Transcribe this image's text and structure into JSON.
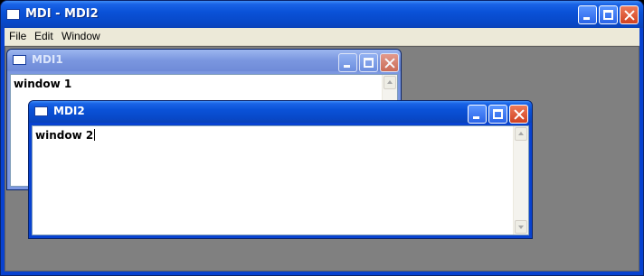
{
  "window": {
    "title": "MDI - MDI2"
  },
  "menu": {
    "items": [
      "File",
      "Edit",
      "Window"
    ]
  },
  "children": [
    {
      "title": "MDI1",
      "text": "window 1",
      "state": "inactive"
    },
    {
      "title": "MDI2",
      "text": "window 2",
      "state": "active"
    }
  ],
  "colors": {
    "titlebar": "#0a52d8",
    "mdi_background": "#808080",
    "menu_background": "#ece9d8",
    "close_button": "#d14120"
  },
  "icons": [
    "window-icon",
    "minimize-icon",
    "maximize-icon",
    "close-icon",
    "scroll-up-arrow-icon",
    "scroll-down-arrow-icon"
  ]
}
